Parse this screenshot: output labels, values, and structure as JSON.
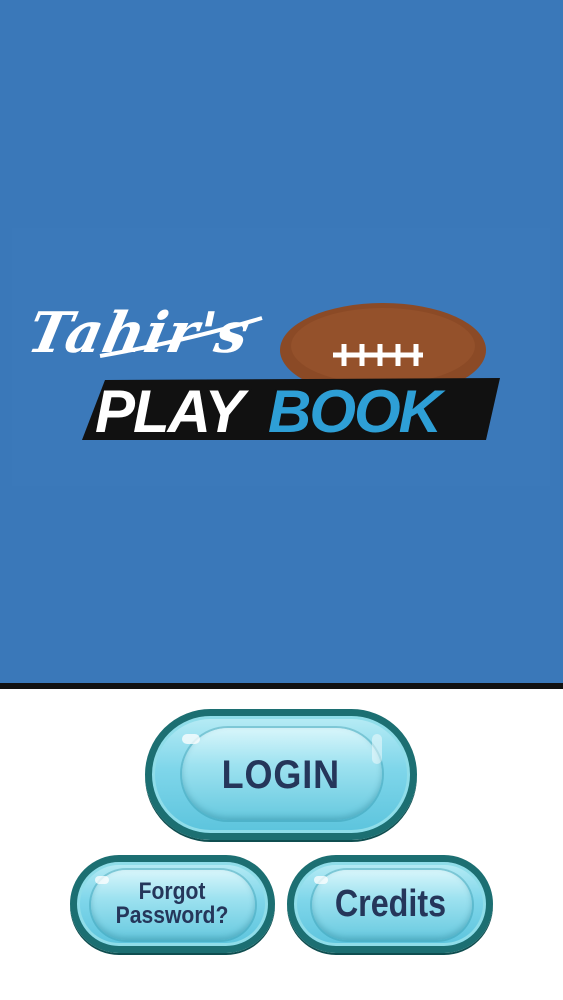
{
  "logo": {
    "script_text": "Tahir's",
    "play_text": "PLAY",
    "book_text": "BOOK"
  },
  "buttons": {
    "login_label": "LOGIN",
    "forgot_line1": "Forgot",
    "forgot_line2": "Password?",
    "credits_label": "Credits"
  },
  "colors": {
    "background_blue": "#3a78b9",
    "book_blue": "#2e9fd6",
    "button_border": "#1c6f72",
    "button_text": "#25365a",
    "football_brown": "#8b4a26"
  },
  "icons": [
    "football-icon"
  ]
}
